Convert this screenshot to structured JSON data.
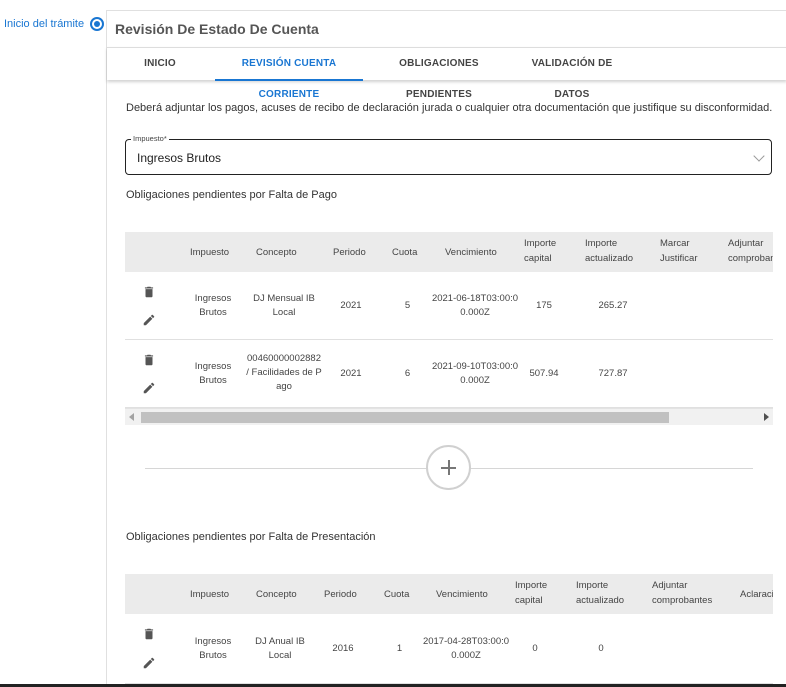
{
  "stepper": {
    "step_label": "Inicio del trámite"
  },
  "panel": {
    "title": "Revisión De Estado De Cuenta"
  },
  "tabs": [
    {
      "label": "INICIO"
    },
    {
      "label": "REVISIÓN CUENTA CORRIENTE"
    },
    {
      "label": "OBLIGACIONES PENDIENTES"
    },
    {
      "label": "VALIDACIÓN DE DATOS"
    }
  ],
  "active_tab": "REVISIÓN CUENTA CORRIENTE",
  "intro_text": "Deberá adjuntar los pagos, acuses de recibo de declaración jurada o cualquier otra documentación que justifique su disconformidad.",
  "impuesto_select": {
    "legend": "Impuesto*",
    "value": "Ingresos Brutos"
  },
  "section_pago": {
    "title": "Obligaciones pendientes por Falta de Pago",
    "headers": [
      "Impuesto",
      "Concepto",
      "Periodo",
      "Cuota",
      "Vencimiento",
      "Importe capital",
      "Importe actualizado",
      "Marcar Justificar",
      "Adjuntar comprobantes"
    ],
    "rows": [
      {
        "impuesto": "Ingresos Brutos",
        "concepto": "DJ Mensual IB Local",
        "periodo": "2021",
        "cuota": "5",
        "vencimiento": "2021-06-18T03:00:00.000Z",
        "capital": "175",
        "actualizado": "265.27"
      },
      {
        "impuesto": "Ingresos Brutos",
        "concepto": "00460000002882 / Facilidades de Pago",
        "periodo": "2021",
        "cuota": "6",
        "vencimiento": "2021-09-10T03:00:00.000Z",
        "capital": "507.94",
        "actualizado": "727.87"
      }
    ]
  },
  "section_presentacion": {
    "title": "Obligaciones pendientes por Falta de Presentación",
    "headers": [
      "Impuesto",
      "Concepto",
      "Periodo",
      "Cuota",
      "Vencimiento",
      "Importe capital",
      "Importe actualizado",
      "Adjuntar comprobantes",
      "Aclaraciones"
    ],
    "rows": [
      {
        "impuesto": "Ingresos Brutos",
        "concepto": "DJ Anual IB Local",
        "periodo": "2016",
        "cuota": "1",
        "vencimiento": "2017-04-28T03:00:00.000Z",
        "capital": "0",
        "actualizado": "0"
      }
    ]
  },
  "colors": {
    "accent": "#1976d2",
    "header_bg": "#ebebeb"
  },
  "icons": [
    "step-indicator-icon",
    "chevron-down-icon",
    "delete-icon",
    "edit-icon",
    "plus-icon"
  ]
}
